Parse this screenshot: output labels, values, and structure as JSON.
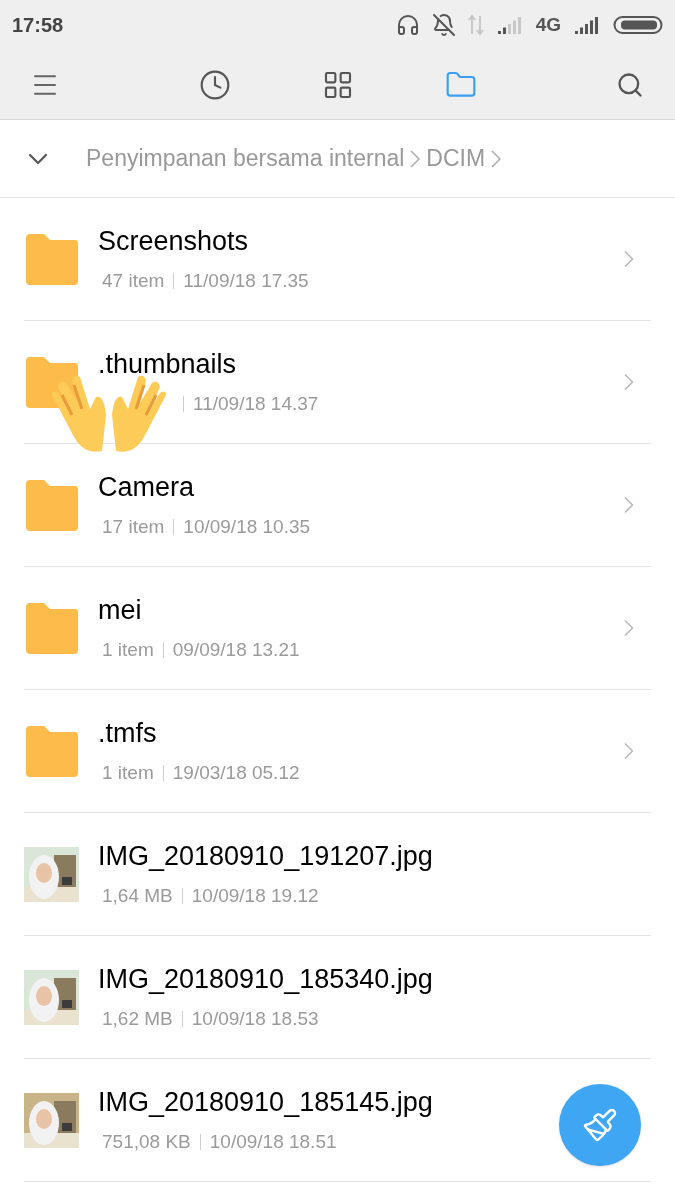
{
  "status_bar": {
    "time": "17:58",
    "network": "4G"
  },
  "tabs": [
    {
      "kind": "recent",
      "selected": false
    },
    {
      "kind": "categories",
      "selected": false
    },
    {
      "kind": "folder",
      "selected": true
    }
  ],
  "breadcrumb": [
    "Penyimpanan bersama internal",
    "DCIM"
  ],
  "items": [
    {
      "kind": "folder",
      "name": "Screenshots",
      "info": "47 item",
      "date": "11/09/18 17.35"
    },
    {
      "kind": "folder",
      "name": ".thumbnails",
      "date": "11/09/18 14.37",
      "sticker": true
    },
    {
      "kind": "folder",
      "name": "Camera",
      "info": "17 item",
      "date": "10/09/18 10.35"
    },
    {
      "kind": "folder",
      "name": "mei",
      "info": "1 item",
      "date": "09/09/18 13.21"
    },
    {
      "kind": "folder",
      "name": ".tmfs",
      "info": "1 item",
      "date": "19/03/18 05.12"
    },
    {
      "name": "IMG_20180910_191207.jpg",
      "info": "1,64 MB",
      "date": "10/09/18 19.12"
    },
    {
      "name": "IMG_20180910_185340.jpg",
      "info": "1,62 MB",
      "date": "10/09/18 18.53"
    },
    {
      "name": "IMG_20180910_185145.jpg",
      "info": "751,08 KB",
      "date": "10/09/18 18.51"
    }
  ]
}
